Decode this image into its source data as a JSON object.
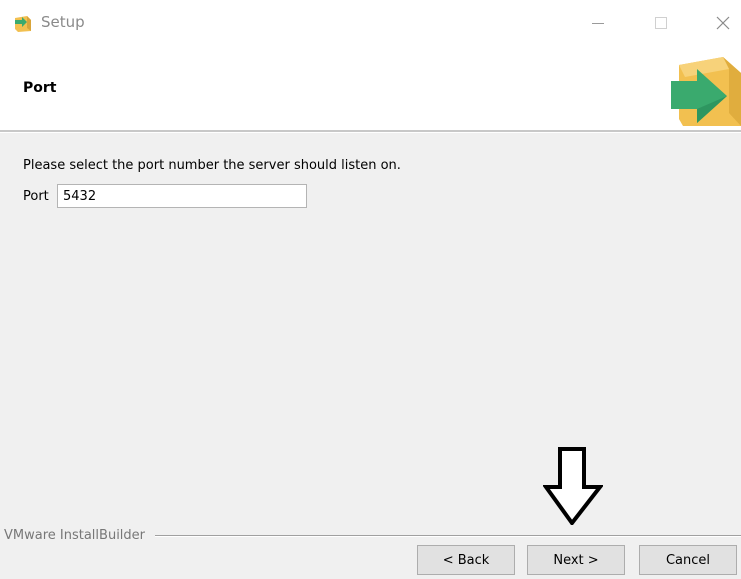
{
  "window": {
    "title": "Setup",
    "controls": {
      "minimize": "minimize-icon",
      "maximize": "maximize-icon",
      "close": "close-icon"
    }
  },
  "header": {
    "title": "Port",
    "logo_icon": "installer-box-arrow-icon"
  },
  "content": {
    "instruction": "Please select the port number the server should listen on.",
    "port_label": "Port",
    "port_value": "5432"
  },
  "footer": {
    "brand": "VMware InstallBuilder",
    "back_label": "< Back",
    "next_label": "Next >",
    "cancel_label": "Cancel"
  },
  "annotation": {
    "icon": "down-arrow-icon"
  },
  "colors": {
    "logo_box": "#f2c050",
    "logo_arrow": "#3aaa6e"
  }
}
